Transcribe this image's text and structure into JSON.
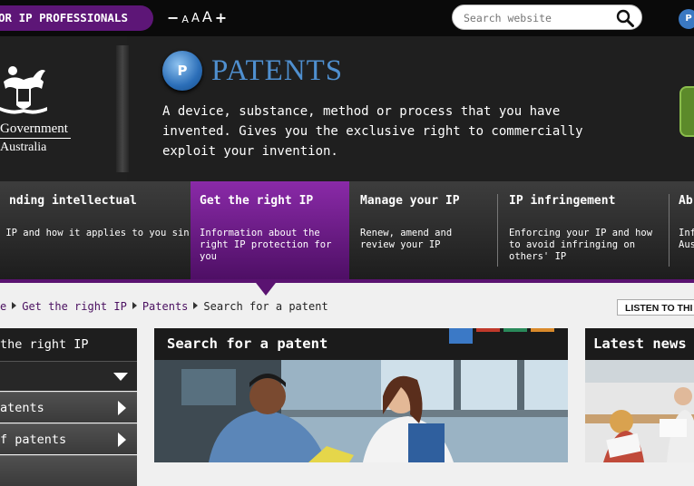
{
  "topbar": {
    "pro_tab": "OR IP PROFESSIONALS",
    "text_size": {
      "decrease": "−",
      "a_small": "A",
      "a_medium": "A",
      "a_large": "A",
      "increase": "+"
    },
    "search_placeholder": "Search website",
    "patents_icon_letter": "P"
  },
  "logo": {
    "line1": "Government",
    "line2": "Australia"
  },
  "hero": {
    "icon_letter": "P",
    "title": "PATENTS",
    "description": "A device, substance, method or process that you have invented. Gives you the exclusive right to commercially exploit your invention."
  },
  "nav": [
    {
      "title": "nding intellectual",
      "desc": " IP and how it applies to you siness"
    },
    {
      "title": "Get the right IP",
      "desc": "Information about the right IP protection for you"
    },
    {
      "title": "Manage your IP",
      "desc": "Renew, amend and review your IP"
    },
    {
      "title": "IP infringement",
      "desc": "Enforcing your IP and how to avoid infringing on others' IP"
    },
    {
      "title": "Ab",
      "desc": "Inf Aus"
    }
  ],
  "breadcrumb": {
    "items": [
      "e",
      "Get the right IP",
      "Patents",
      "Search for a patent"
    ]
  },
  "listen_label": "LISTEN TO THI",
  "sidebar": {
    "heading": "the right IP",
    "items": [
      "atents",
      "f patents"
    ]
  },
  "main": {
    "title": "Search for a patent",
    "tab_colors": [
      "#3b79c6",
      "#c0392b",
      "#2a8a5a",
      "#d98a2b"
    ]
  },
  "news": {
    "title": "Latest news"
  },
  "colors": {
    "purple": "#5d1677",
    "blue_title": "#4f8fcf",
    "dark": "#1b1b1b"
  }
}
